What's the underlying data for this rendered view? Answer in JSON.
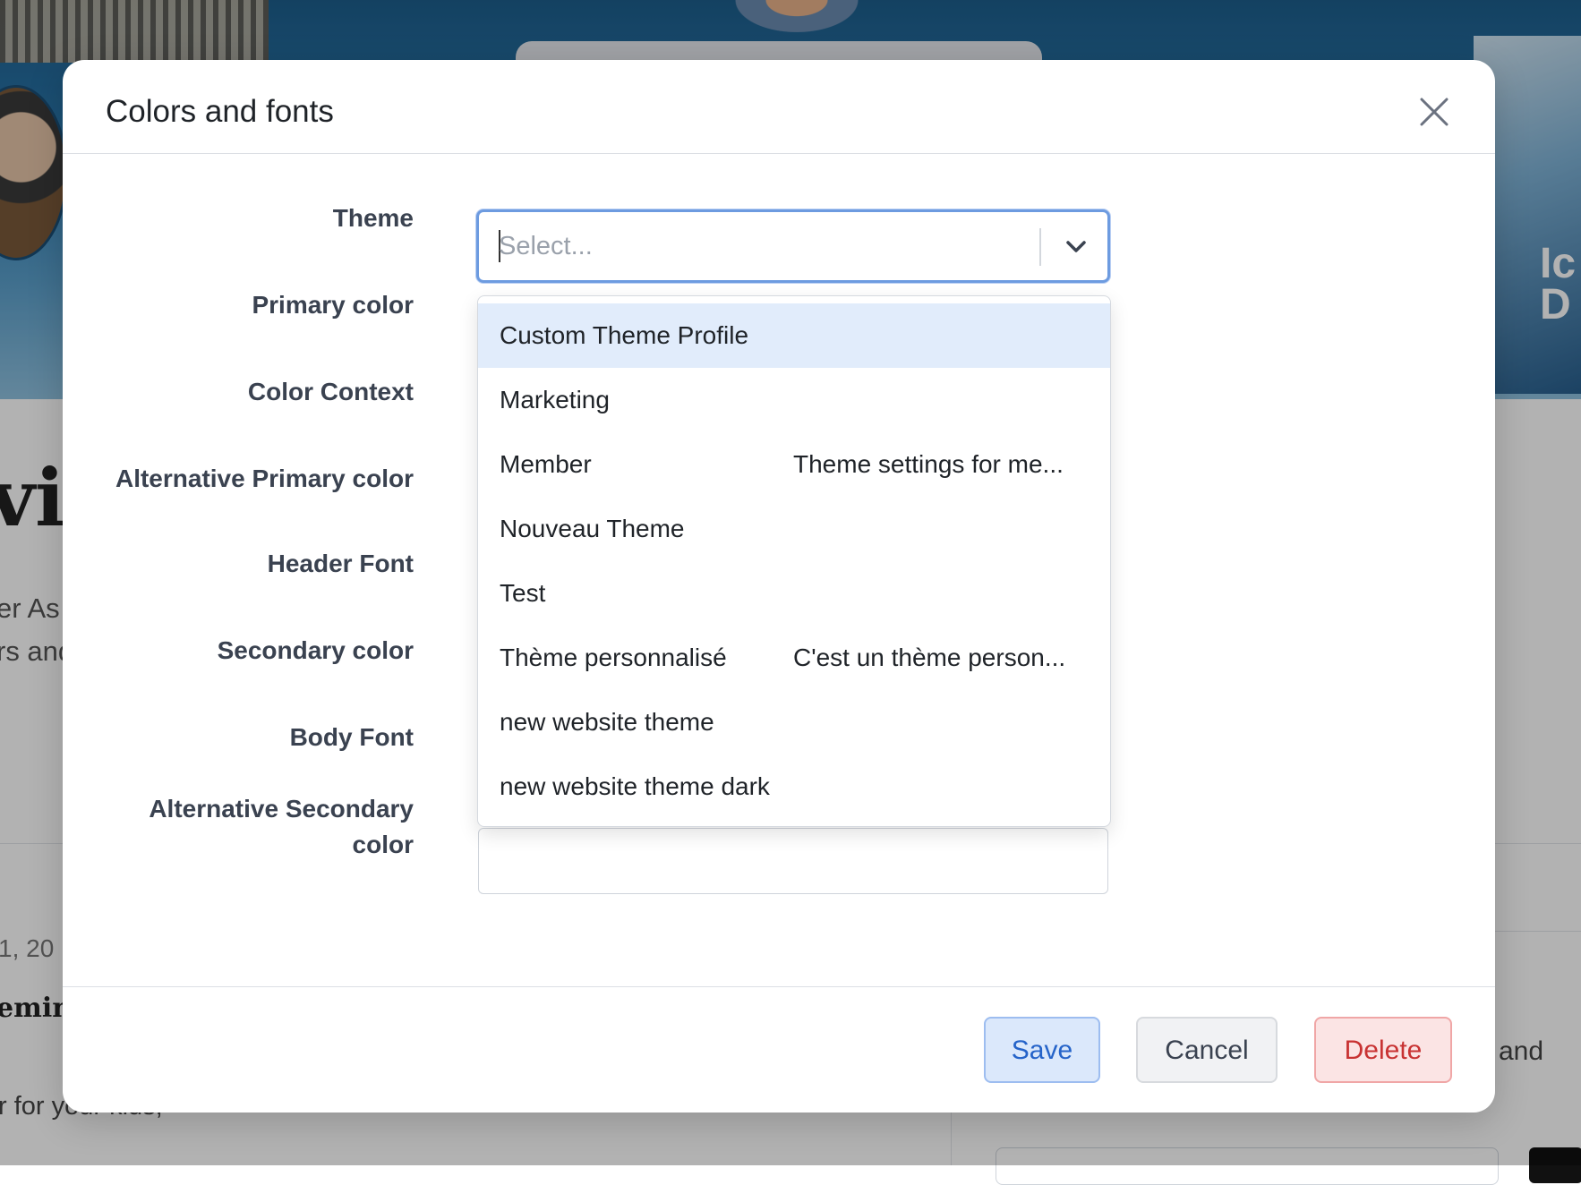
{
  "background": {
    "banner_text": "Ic D",
    "heading_fragment": "vit",
    "paragraph_line1": "er As",
    "paragraph_line2": "rs and",
    "date_fragment": "1, 20",
    "remind_fragment": "emind",
    "kids_fragment": "r for your kids,",
    "and_fragment": "and"
  },
  "modal": {
    "title": "Colors and fonts",
    "labels": {
      "theme": "Theme",
      "primary_color": "Primary color",
      "color_context": "Color Context",
      "alt_primary_color": "Alternative Primary color",
      "header_font": "Header Font",
      "secondary_color": "Secondary color",
      "body_font": "Body Font",
      "alt_secondary_color_line1": "Alternative Secondary",
      "alt_secondary_color_line2": "color"
    },
    "theme_select": {
      "placeholder": "Select..."
    },
    "dropdown_options": [
      {
        "name": "Custom Theme Profile",
        "description": ""
      },
      {
        "name": "Marketing",
        "description": ""
      },
      {
        "name": "Member",
        "description": "Theme settings for me..."
      },
      {
        "name": "Nouveau Theme",
        "description": ""
      },
      {
        "name": "Test",
        "description": ""
      },
      {
        "name": "Thème personnalisé",
        "description": "C'est un thème person..."
      },
      {
        "name": "new website theme",
        "description": ""
      },
      {
        "name": "new website theme dark",
        "description": ""
      }
    ],
    "buttons": {
      "save": "Save",
      "cancel": "Cancel",
      "delete": "Delete"
    }
  },
  "colors": {
    "accent_blue": "#6d9be0",
    "highlight": "#e1ecfb",
    "danger": "#c83232"
  }
}
